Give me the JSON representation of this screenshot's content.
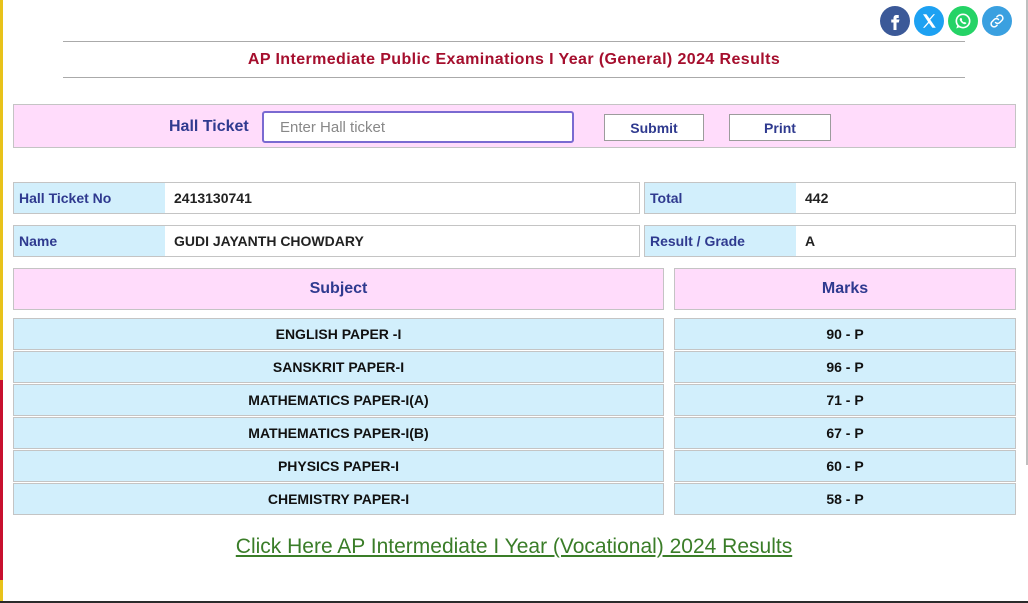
{
  "header": {
    "title": "AP Intermediate Public Examinations I Year (General) 2024 Results",
    "share_icons": [
      "facebook-icon",
      "x-twitter-icon",
      "whatsapp-icon",
      "link-icon"
    ]
  },
  "search": {
    "label": "Hall Ticket",
    "placeholder": "Enter Hall ticket",
    "submit_label": "Submit",
    "print_label": "Print"
  },
  "student": {
    "hall_ticket_label": "Hall Ticket No",
    "hall_ticket_value": "2413130741",
    "name_label": "Name",
    "name_value": "GUDI JAYANTH CHOWDARY",
    "total_label": "Total",
    "total_value": "442",
    "result_label": "Result / Grade",
    "result_value": "A"
  },
  "marks_table": {
    "headers": {
      "subject": "Subject",
      "marks": "Marks"
    },
    "rows": [
      {
        "subject": "ENGLISH PAPER -I",
        "marks": "90 - P"
      },
      {
        "subject": "SANSKRIT PAPER-I",
        "marks": "96 - P"
      },
      {
        "subject": "MATHEMATICS PAPER-I(A)",
        "marks": "71 - P"
      },
      {
        "subject": "MATHEMATICS PAPER-I(B)",
        "marks": "67 - P"
      },
      {
        "subject": "PHYSICS PAPER-I",
        "marks": "60 - P"
      },
      {
        "subject": "CHEMISTRY PAPER-I",
        "marks": "58 - P"
      }
    ]
  },
  "footer_link": {
    "label": "Click Here AP Intermediate I Year (Vocational) 2024 Results"
  },
  "colors": {
    "title": "#a50e2d",
    "label": "#2f3a8f",
    "pink_bg": "#ffdcfb",
    "blue_bg": "#d2effc",
    "link": "#3a7d28"
  }
}
